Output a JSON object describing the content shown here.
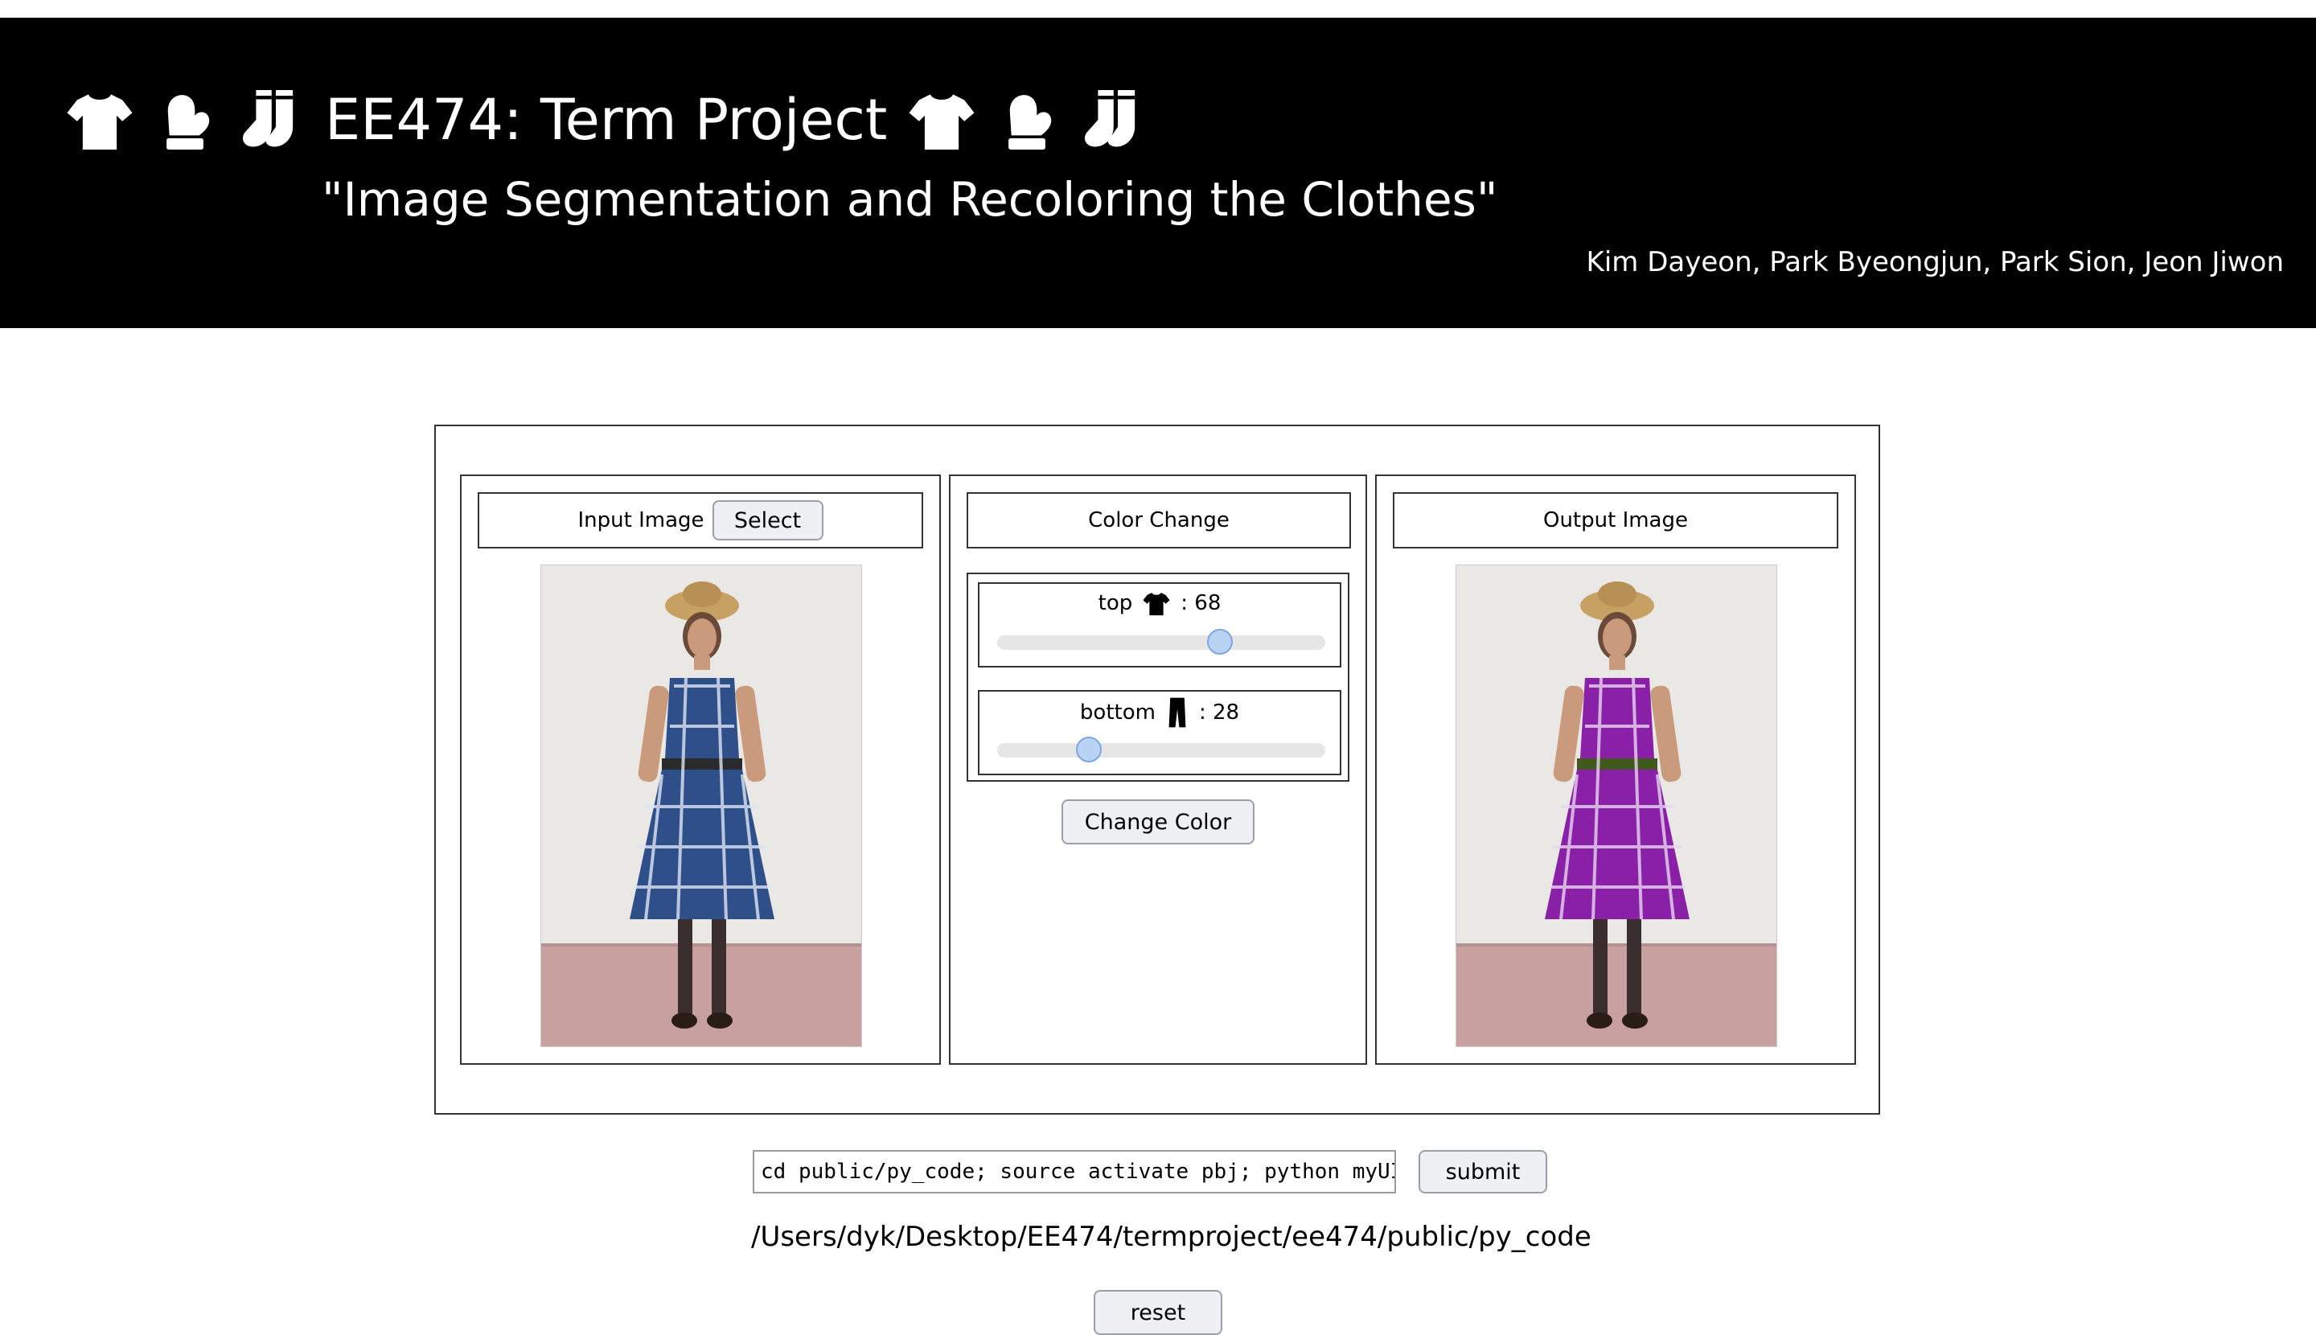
{
  "header": {
    "title": "EE474: Term Project",
    "subtitle": "\"Image Segmentation and Recoloring the Clothes\"",
    "authors": "Kim Dayeon, Park Byeongjun, Park Sion, Jeon Jiwon",
    "icons": [
      "tshirt-icon",
      "mitten-icon",
      "socks-icon"
    ]
  },
  "input_panel": {
    "title": "Input Image",
    "select_label": "Select"
  },
  "color_panel": {
    "title": "Color Change",
    "top": {
      "label": "top",
      "value": "68",
      "value_text": ": 68",
      "max": 100
    },
    "bottom": {
      "label": "bottom",
      "value": "28",
      "value_text": ": 28",
      "max": 100
    },
    "change_label": "Change Color"
  },
  "output_panel": {
    "title": "Output Image"
  },
  "command": {
    "value": "cd public/py_code; source activate pbj; python myUI.py --imag",
    "submit_label": "submit"
  },
  "path_text": "/Users/dyk/Desktop/EE474/termproject/ee474/public/py_code",
  "reset_label": "reset",
  "colors": {
    "header_bg": "#000000",
    "dress_input": "#2f4f8a",
    "dress_output": "#8a1fa8",
    "slider_thumb": "#b9d3f5"
  }
}
